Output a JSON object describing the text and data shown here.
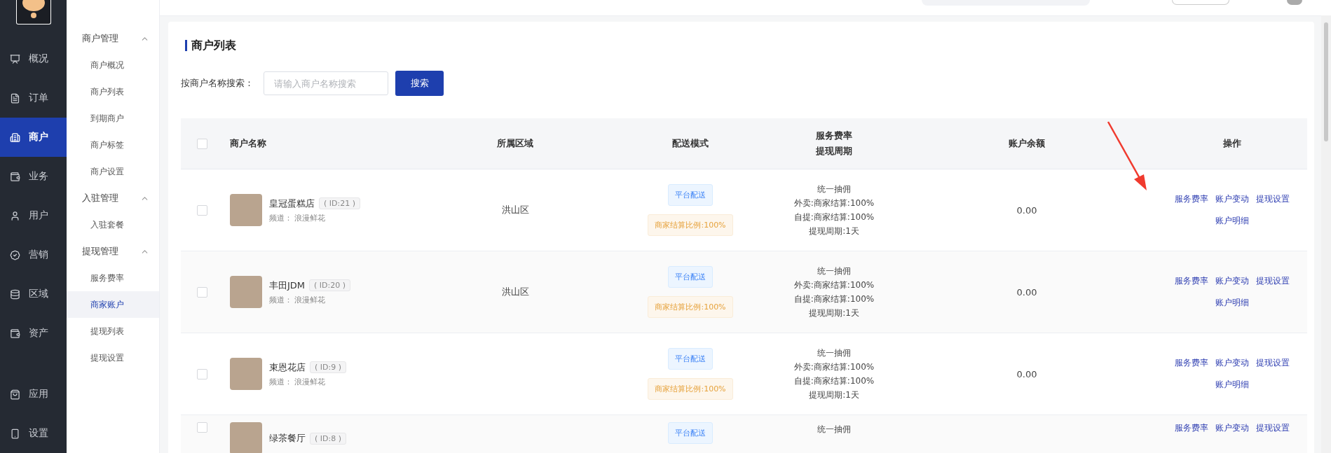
{
  "sidebar": {
    "items": [
      {
        "label": "概况",
        "selected": false
      },
      {
        "label": "订单",
        "selected": false
      },
      {
        "label": "商户",
        "selected": true
      },
      {
        "label": "业务",
        "selected": false
      },
      {
        "label": "用户",
        "selected": false
      },
      {
        "label": "营销",
        "selected": false
      },
      {
        "label": "区域",
        "selected": false
      },
      {
        "label": "资产",
        "selected": false
      }
    ],
    "bottom_items": [
      {
        "label": "应用",
        "selected": false
      },
      {
        "label": "设置",
        "selected": false
      }
    ]
  },
  "submenu": {
    "groups": [
      {
        "title": "商户管理",
        "expanded": true,
        "items": [
          {
            "label": "商户概况",
            "selected": false
          },
          {
            "label": "商户列表",
            "selected": false
          },
          {
            "label": "到期商户",
            "selected": false
          },
          {
            "label": "商户标签",
            "selected": false
          },
          {
            "label": "商户设置",
            "selected": false
          }
        ]
      },
      {
        "title": "入驻管理",
        "expanded": true,
        "items": [
          {
            "label": "入驻套餐",
            "selected": false
          }
        ]
      },
      {
        "title": "提现管理",
        "expanded": true,
        "items": [
          {
            "label": "服务费率",
            "selected": false
          },
          {
            "label": "商家账户",
            "selected": true
          },
          {
            "label": "提现列表",
            "selected": false
          },
          {
            "label": "提现设置",
            "selected": false
          }
        ]
      }
    ]
  },
  "page": {
    "title": "商户列表",
    "search": {
      "label": "按商户名称搜索：",
      "placeholder": "请输入商户名称搜索",
      "button": "搜索"
    }
  },
  "table": {
    "header_checked": false,
    "columns": [
      {
        "lines": [
          "商户名称"
        ]
      },
      {
        "lines": [
          "所属区域"
        ]
      },
      {
        "lines": [
          "配送模式"
        ]
      },
      {
        "lines": [
          "服务费率",
          "提现周期"
        ]
      },
      {
        "lines": [
          "账户余额"
        ]
      },
      {
        "lines": [
          "操作"
        ]
      }
    ],
    "rows": [
      {
        "checked": false,
        "name": "皇冠蛋糕店",
        "id": "( ID:21 )",
        "channel": "频道： 浪漫鲜花",
        "region": "洪山区",
        "tags": [
          {
            "text": "平台配送",
            "kind": "platform"
          },
          {
            "text": "商家结算比例:100%",
            "kind": "ratio"
          }
        ],
        "fees": [
          "统一抽佣",
          "外卖:商家结算:100%",
          "自提:商家结算:100%",
          "提现周期:1天"
        ],
        "balance": "0.00",
        "actions": [
          "服务费率",
          "账户变动",
          "提现设置",
          "账户明细"
        ]
      },
      {
        "checked": false,
        "name": "丰田JDM",
        "id": "( ID:20 )",
        "channel": "频道： 浪漫鲜花",
        "region": "洪山区",
        "tags": [
          {
            "text": "平台配送",
            "kind": "platform"
          },
          {
            "text": "商家结算比例:100%",
            "kind": "ratio"
          }
        ],
        "fees": [
          "统一抽佣",
          "外卖:商家结算:100%",
          "自提:商家结算:100%",
          "提现周期:1天"
        ],
        "balance": "0.00",
        "actions": [
          "服务费率",
          "账户变动",
          "提现设置",
          "账户明细"
        ]
      },
      {
        "checked": false,
        "name": "束恩花店",
        "id": "( ID:9 )",
        "channel": "频道： 浪漫鲜花",
        "tags": [
          {
            "text": "平台配送",
            "kind": "platform"
          },
          {
            "text": "商家结算比例:100%",
            "kind": "ratio"
          }
        ],
        "fees": [
          "统一抽佣",
          "外卖:商家结算:100%",
          "自提:商家结算:100%",
          "提现周期:1天"
        ],
        "balance": "0.00",
        "actions": [
          "服务费率",
          "账户变动",
          "提现设置",
          "账户明细"
        ]
      },
      {
        "checked": false,
        "name": "绿茶餐厅",
        "id": "( ID:8 )",
        "tags": [
          {
            "text": "平台配送",
            "kind": "platform"
          }
        ],
        "fees": [
          "统一抽佣"
        ],
        "actions": [
          "服务费率",
          "账户变动",
          "提现设置"
        ]
      }
    ]
  }
}
